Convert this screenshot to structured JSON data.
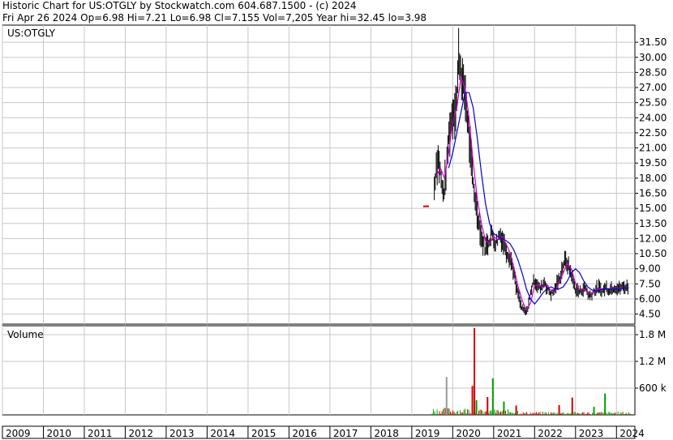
{
  "header": {
    "line1": "Historic Chart for US:OTGLY by Stockwatch.com 604.687.1500 - (c) 2024",
    "line2": "Fri Apr 26 2024   Op=6.98  Hi=7.21  Lo=6.98  Cl=7.155  Vol=7,205  Year hi=32.45  lo=3.98"
  },
  "colors": {
    "price_bar": "#000000",
    "ma_short": "#cc00cc",
    "ma_long": "#0000cc",
    "vol_up": "#00a000",
    "vol_down": "#d00000",
    "vol_neutral": "#999999",
    "grid": "#c8c8c8"
  },
  "chart_data": [
    {
      "type": "line",
      "legend": "US:OTGLY",
      "x_range": [
        2009,
        2024.45
      ],
      "ylim": [
        3.5,
        33.2
      ],
      "grid": true,
      "y_ticks": [
        4.5,
        6.0,
        7.5,
        9.0,
        10.5,
        12.0,
        13.5,
        15.0,
        16.5,
        18.0,
        19.5,
        21.0,
        22.5,
        24.0,
        25.5,
        27.0,
        28.5,
        30.0,
        31.5
      ],
      "y_tick_labels": [
        "4.50",
        "6.00",
        "7.50",
        "9.00",
        "10.50",
        "12.00",
        "13.50",
        "15.00",
        "16.50",
        "18.00",
        "19.50",
        "21.00",
        "22.50",
        "24.00",
        "25.50",
        "27.00",
        "28.50",
        "30.00",
        "31.50"
      ],
      "series": [
        {
          "role": "close",
          "x": [
            2019.55,
            2019.6,
            2019.65,
            2019.7,
            2019.75,
            2019.8,
            2019.85,
            2019.9,
            2019.95,
            2020.0,
            2020.05,
            2020.1,
            2020.15,
            2020.2,
            2020.25,
            2020.3,
            2020.35,
            2020.4,
            2020.45,
            2020.5,
            2020.55,
            2020.6,
            2020.65,
            2020.7,
            2020.75,
            2020.8,
            2020.85,
            2020.9,
            2020.95,
            2021.0,
            2021.05,
            2021.1,
            2021.15,
            2021.2,
            2021.25,
            2021.3,
            2021.35,
            2021.4,
            2021.45,
            2021.5,
            2021.55,
            2021.6,
            2021.65,
            2021.7,
            2021.75,
            2021.8,
            2021.85,
            2021.9,
            2021.95,
            2022.0,
            2022.05,
            2022.1,
            2022.15,
            2022.2,
            2022.25,
            2022.3,
            2022.35,
            2022.4,
            2022.45,
            2022.5,
            2022.55,
            2022.6,
            2022.65,
            2022.7,
            2022.75,
            2022.8,
            2022.85,
            2022.9,
            2022.95,
            2023.0,
            2023.05,
            2023.1,
            2023.15,
            2023.2,
            2023.25,
            2023.3,
            2023.35,
            2023.4,
            2023.45,
            2023.5,
            2023.55,
            2023.6,
            2023.65,
            2023.7,
            2023.75,
            2023.8,
            2023.85,
            2023.9,
            2023.95,
            2024.0,
            2024.05,
            2024.1,
            2024.15,
            2024.2,
            2024.25,
            2024.3
          ],
          "y": [
            17.0,
            19.5,
            20.0,
            18.5,
            16.5,
            17.0,
            19.0,
            22.0,
            23.5,
            24.5,
            25.0,
            26.0,
            30.5,
            29.0,
            27.0,
            26.5,
            24.5,
            22.0,
            19.5,
            17.5,
            16.0,
            14.5,
            13.5,
            12.0,
            11.5,
            11.0,
            11.5,
            12.0,
            12.5,
            12.0,
            11.5,
            12.0,
            12.5,
            12.0,
            11.5,
            11.0,
            10.5,
            10.0,
            9.5,
            8.5,
            7.0,
            6.5,
            5.5,
            5.0,
            4.8,
            4.6,
            5.5,
            6.5,
            7.5,
            7.8,
            7.5,
            7.2,
            7.0,
            7.5,
            7.8,
            7.0,
            6.8,
            6.5,
            6.6,
            7.0,
            7.5,
            8.0,
            8.5,
            9.5,
            9.8,
            9.5,
            9.0,
            8.5,
            7.5,
            7.0,
            6.8,
            6.7,
            6.9,
            7.0,
            7.2,
            6.5,
            6.3,
            6.5,
            6.8,
            6.9,
            7.1,
            7.0,
            6.7,
            7.0,
            7.2,
            6.9,
            7.0,
            7.1,
            7.2,
            7.1,
            7.0,
            7.1,
            7.2,
            7.15,
            7.2,
            7.155
          ]
        },
        {
          "role": "moving-average-short",
          "x": [
            2019.6,
            2019.7,
            2019.8,
            2019.9,
            2020.0,
            2020.1,
            2020.2,
            2020.3,
            2020.4,
            2020.5,
            2020.6,
            2020.7,
            2020.8,
            2020.9,
            2021.0,
            2021.1,
            2021.2,
            2021.3,
            2021.4,
            2021.5,
            2021.6,
            2021.7,
            2021.8,
            2021.9,
            2022.0,
            2022.1,
            2022.2,
            2022.3,
            2022.4,
            2022.5,
            2022.6,
            2022.7,
            2022.8,
            2022.9,
            2023.0,
            2023.1,
            2023.2,
            2023.3,
            2023.4,
            2023.5,
            2023.6,
            2023.7,
            2023.8,
            2023.9,
            2024.0,
            2024.1,
            2024.2,
            2024.3
          ],
          "y": [
            18.2,
            19.0,
            18.0,
            20.5,
            23.5,
            25.0,
            28.0,
            27.0,
            24.0,
            19.5,
            16.0,
            13.5,
            11.8,
            11.5,
            12.2,
            11.9,
            12.2,
            11.5,
            10.6,
            9.0,
            7.2,
            5.8,
            4.9,
            5.6,
            7.3,
            7.4,
            7.1,
            7.4,
            6.8,
            6.7,
            7.6,
            8.6,
            9.5,
            9.0,
            7.5,
            6.9,
            7.0,
            6.6,
            6.5,
            6.9,
            7.0,
            7.0,
            7.0,
            7.1,
            7.0,
            7.1,
            7.1,
            7.15
          ]
        },
        {
          "role": "moving-average-long",
          "x": [
            2019.9,
            2020.0,
            2020.1,
            2020.2,
            2020.3,
            2020.4,
            2020.5,
            2020.6,
            2020.7,
            2020.8,
            2020.9,
            2021.0,
            2021.1,
            2021.2,
            2021.3,
            2021.4,
            2021.5,
            2021.6,
            2021.7,
            2021.8,
            2021.9,
            2022.0,
            2022.1,
            2022.2,
            2022.3,
            2022.4,
            2022.5,
            2022.6,
            2022.7,
            2022.8,
            2022.9,
            2023.0,
            2023.1,
            2023.2,
            2023.3,
            2023.4,
            2023.5,
            2023.6,
            2023.7,
            2023.8,
            2023.9,
            2024.0,
            2024.1,
            2024.2,
            2024.3
          ],
          "y": [
            19.0,
            20.5,
            22.5,
            24.5,
            26.5,
            26.5,
            25.0,
            22.0,
            18.5,
            15.5,
            13.5,
            12.5,
            12.2,
            12.0,
            11.8,
            11.5,
            10.8,
            9.8,
            8.5,
            7.0,
            6.0,
            5.5,
            6.0,
            6.6,
            7.0,
            7.2,
            7.0,
            7.0,
            7.2,
            7.8,
            8.6,
            9.0,
            8.6,
            7.8,
            7.2,
            6.9,
            6.8,
            6.9,
            7.0,
            7.0,
            7.0,
            7.0,
            7.0,
            7.1,
            7.1
          ]
        }
      ]
    },
    {
      "type": "bar",
      "legend": "Volume",
      "ylim": [
        0,
        2000000
      ],
      "y_ticks": [
        600000,
        1200000,
        1800000
      ],
      "y_tick_labels": [
        "600 k",
        "1.2 M",
        "1.8 M"
      ],
      "x_labels": [
        "2009",
        "2010",
        "2011",
        "2012",
        "2013",
        "2014",
        "2015",
        "2016",
        "2017",
        "2018",
        "2019",
        "2020",
        "2021",
        "2022",
        "2023",
        "2024"
      ],
      "x_label_years": [
        2009,
        2010,
        2011,
        2012,
        2013,
        2014,
        2015,
        2016,
        2017,
        2018,
        2019,
        2020,
        2021,
        2022,
        2023,
        2024
      ],
      "spikes": [
        {
          "x": 2019.85,
          "value": 850000,
          "dir": "neutral"
        },
        {
          "x": 2020.53,
          "value": 1950000,
          "dir": "down"
        },
        {
          "x": 2020.48,
          "value": 650000,
          "dir": "down"
        },
        {
          "x": 2020.58,
          "value": 330000,
          "dir": "up"
        },
        {
          "x": 2020.98,
          "value": 820000,
          "dir": "up"
        },
        {
          "x": 2020.85,
          "value": 400000,
          "dir": "down"
        },
        {
          "x": 2021.25,
          "value": 300000,
          "dir": "up"
        },
        {
          "x": 2021.55,
          "value": 210000,
          "dir": "down"
        },
        {
          "x": 2022.6,
          "value": 220000,
          "dir": "down"
        },
        {
          "x": 2022.92,
          "value": 390000,
          "dir": "down"
        },
        {
          "x": 2023.72,
          "value": 480000,
          "dir": "up"
        },
        {
          "x": 2023.45,
          "value": 180000,
          "dir": "up"
        }
      ],
      "baseline": [
        {
          "x_range": [
            2019.5,
            2020.4
          ],
          "value": 90000
        },
        {
          "x_range": [
            2020.4,
            2021.6
          ],
          "value": 70000
        },
        {
          "x_range": [
            2021.6,
            2024.35
          ],
          "value": 40000
        }
      ]
    }
  ]
}
